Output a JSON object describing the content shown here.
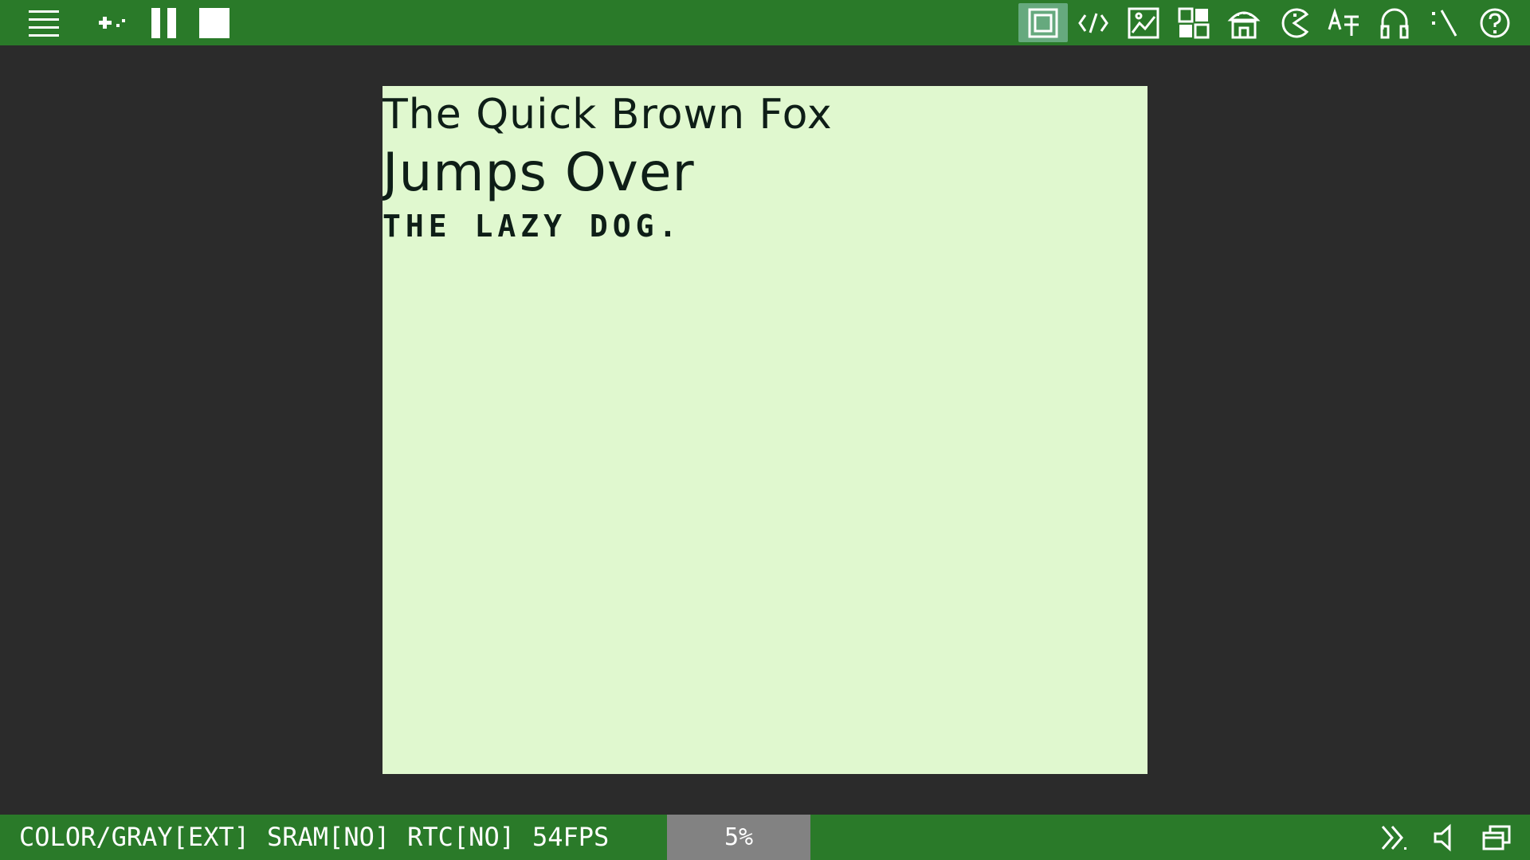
{
  "toolbar": {
    "left": [
      {
        "icon": "menu-icon"
      },
      {
        "icon": "gamepad-icon"
      },
      {
        "icon": "pause-icon"
      },
      {
        "icon": "stop-icon"
      }
    ],
    "right": [
      {
        "icon": "screen-icon",
        "active": true
      },
      {
        "icon": "code-icon"
      },
      {
        "icon": "image-icon"
      },
      {
        "icon": "tiles-icon"
      },
      {
        "icon": "shop-icon"
      },
      {
        "icon": "pacman-icon"
      },
      {
        "icon": "translate-icon"
      },
      {
        "icon": "headphones-icon"
      },
      {
        "icon": "terminal-icon"
      },
      {
        "icon": "help-icon"
      }
    ],
    "accent": "#2a7a29",
    "active_bg": "#66a97e"
  },
  "screen": {
    "background": "#e0f8cf",
    "text_color": "#0e1e17",
    "lines": [
      "The Quick Brown Fox",
      "Jumps Over",
      "THE LAZY DOG."
    ]
  },
  "status": {
    "mode": "COLOR/GRAY[EXT]",
    "sram": "SRAM[NO]",
    "rtc": "RTC[NO]",
    "fps": "54FPS",
    "percent": "5%",
    "icons": [
      "fast-forward-icon",
      "volume-icon",
      "window-icon"
    ]
  }
}
